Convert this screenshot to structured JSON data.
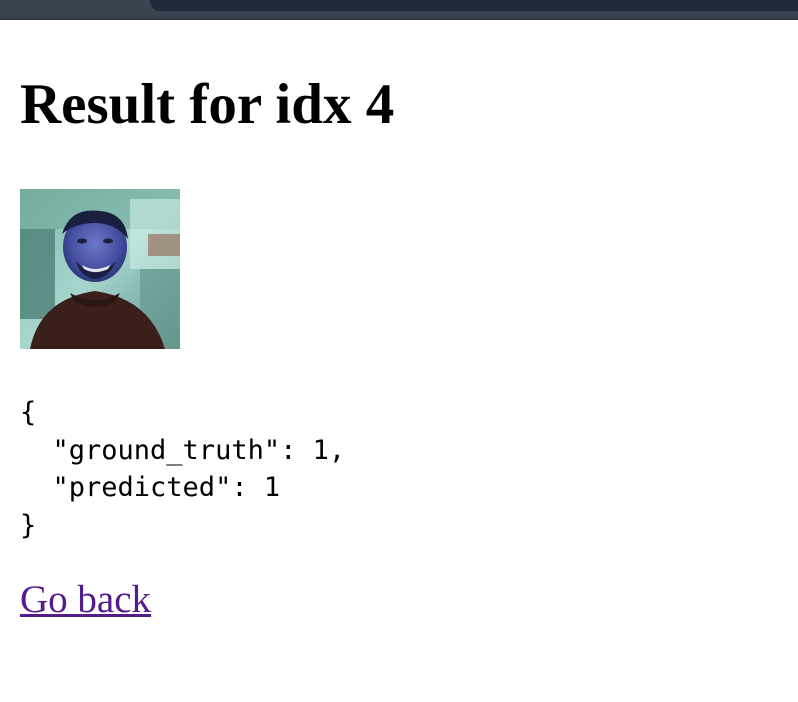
{
  "page": {
    "title": "Result for idx 4",
    "image_alt": "sample image idx 4",
    "result_json": "{\n  \"ground_truth\": 1,\n  \"predicted\": 1\n}",
    "back_link": "Go back"
  },
  "colors": {
    "link_visited": "#551a8b",
    "browser_chrome": "#3a4350"
  }
}
